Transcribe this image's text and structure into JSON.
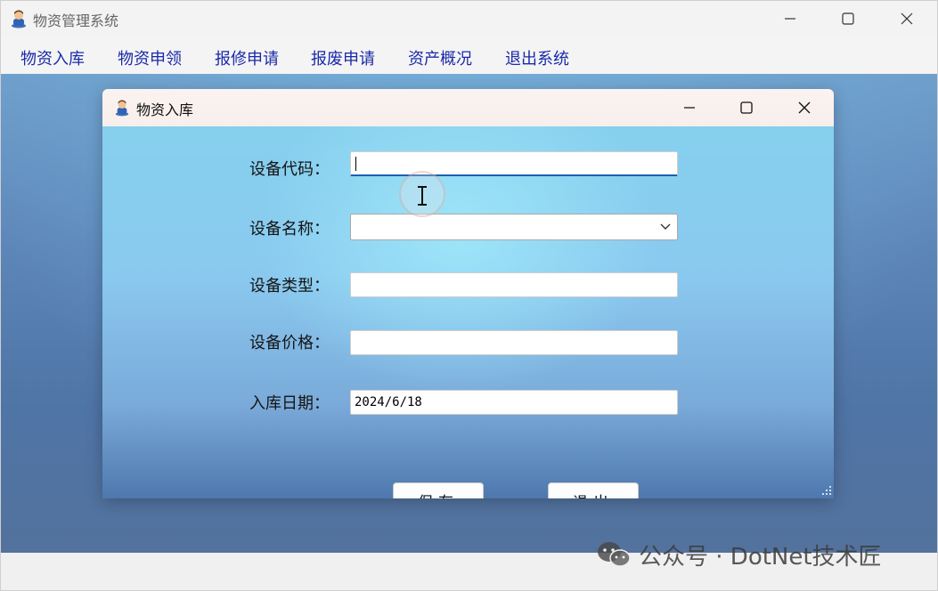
{
  "main_window": {
    "title": "物资管理系统",
    "controls": {
      "minimize": "minimize",
      "maximize": "maximize",
      "close": "close"
    }
  },
  "menu": {
    "items": [
      "物资入库",
      "物资申领",
      "报修申请",
      "报废申请",
      "资产概况",
      "退出系统"
    ]
  },
  "dialog": {
    "title": "物资入库",
    "fields": [
      {
        "label": "设备代码：",
        "value": ""
      },
      {
        "label": "设备名称：",
        "value": ""
      },
      {
        "label": "设备类型：",
        "value": ""
      },
      {
        "label": "设备价格：",
        "value": ""
      },
      {
        "label": "入库日期：",
        "value": "2024/6/18"
      }
    ],
    "buttons": {
      "save": "保存",
      "exit": "退出"
    }
  },
  "watermark": {
    "text": "公众号 · DotNet技术匠"
  },
  "colors": {
    "menu_text": "#1a2aa8",
    "focus_underline": "#1b5fb0",
    "dialog_bg": "#86d0ee",
    "mdi_bg": "#5d86b8"
  }
}
